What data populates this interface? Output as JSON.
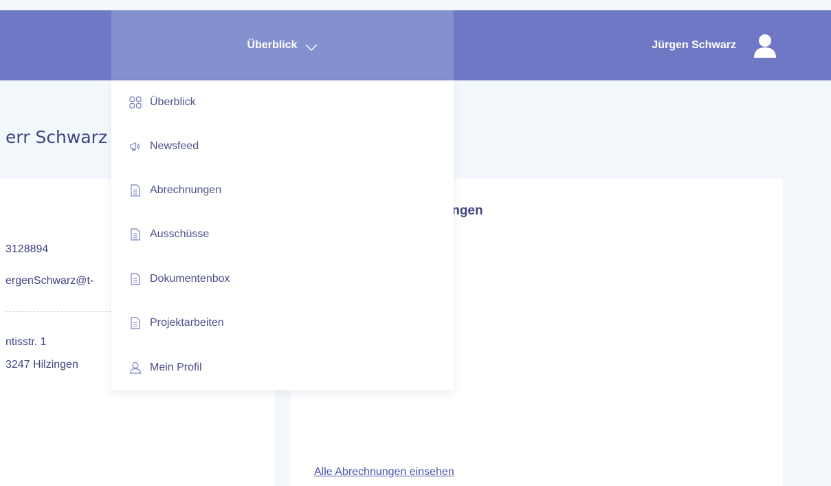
{
  "header": {
    "nav_label": "Überblick",
    "user_name": "Jürgen Schwarz"
  },
  "greeting": "err Schwarz",
  "contact": {
    "phone": "3128894",
    "email": "ergenSchwarz@t-",
    "street": "ntisstr. 1",
    "city": "3247 Hilzingen"
  },
  "billing": {
    "title": "nungen",
    "link": "Alle Abrechnungen einsehen"
  },
  "menu": {
    "items": [
      {
        "label": "Überblick",
        "icon": "grid-icon"
      },
      {
        "label": "Newsfeed",
        "icon": "megaphone-icon"
      },
      {
        "label": "Abrechnungen",
        "icon": "document-icon"
      },
      {
        "label": "Ausschüsse",
        "icon": "document-icon"
      },
      {
        "label": "Dokumentenbox",
        "icon": "document-icon"
      },
      {
        "label": "Projektarbeiten",
        "icon": "document-icon"
      },
      {
        "label": "Mein Profil",
        "icon": "user-icon"
      }
    ]
  },
  "colors": {
    "header": "#6f78c4",
    "header_active": "#8590cf",
    "page_bg": "#f3f8fd",
    "text": "#4b4f8a"
  }
}
